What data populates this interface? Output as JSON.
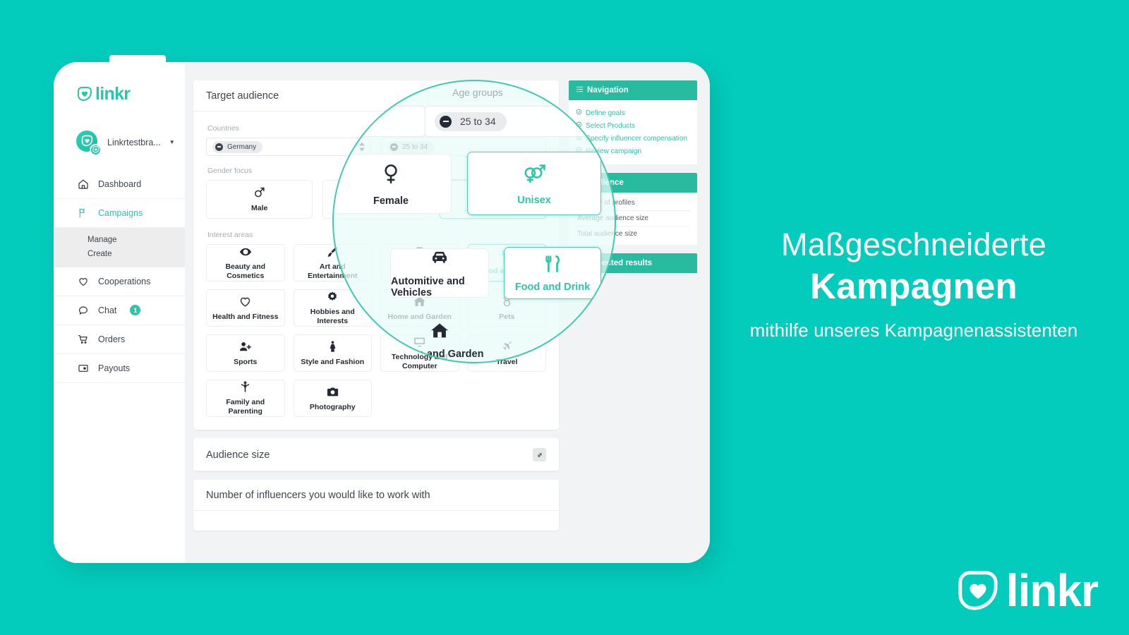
{
  "background_color": "#04ccbc",
  "accent_color": "#2ec4a8",
  "panel_header_color": "#28bba0",
  "promo": {
    "line1": "Maßgeschneiderte",
    "line2": "Kampagnen",
    "line3": "mithilfe unseres Kampagnenassistenten"
  },
  "brand_logo": {
    "word": "linkr",
    "icon": "linkr-shield-heart-icon"
  },
  "sidebar": {
    "logo_word": "linkr",
    "account": {
      "name": "Linkrtestbra...",
      "caret": "▼"
    },
    "items": [
      {
        "label": "Dashboard",
        "icon": "home-icon",
        "active": false
      },
      {
        "label": "Campaigns",
        "icon": "flag-icon",
        "active": true
      },
      {
        "label": "Cooperations",
        "icon": "heart-icon",
        "active": false
      },
      {
        "label": "Chat",
        "icon": "chat-bubble-icon",
        "active": false,
        "badge": "1"
      },
      {
        "label": "Orders",
        "icon": "cart-icon",
        "active": false
      },
      {
        "label": "Payouts",
        "icon": "payout-card-icon",
        "active": false
      }
    ],
    "subnav": [
      {
        "label": "Manage"
      },
      {
        "label": "Create"
      }
    ]
  },
  "main": {
    "target_audience": {
      "title": "Target audience",
      "countries_label": "Countries",
      "country_tags": [
        "Germany"
      ],
      "age_groups_label": "Age groups",
      "age_tags": [
        "25 to 34"
      ],
      "gender_label": "Gender focus",
      "genders": [
        {
          "label": "Male",
          "icon": "mars-icon",
          "selected": false
        },
        {
          "label": "Female",
          "icon": "venus-icon",
          "selected": false
        },
        {
          "label": "Unisex",
          "icon": "unisex-icon",
          "selected": true
        }
      ],
      "interest_label": "Interest areas",
      "interests": [
        {
          "label": "Beauty and Cosmetics",
          "icon": "eye-icon",
          "selected": false
        },
        {
          "label": "Art and Entertainment",
          "icon": "paintbrush-icon",
          "selected": false
        },
        {
          "label": "Automitive and Vehicles",
          "icon": "car-icon",
          "selected": false
        },
        {
          "label": "Food and Drink",
          "icon": "fork-knife-icon",
          "selected": true
        },
        {
          "label": "Health and Fitness",
          "icon": "heart-icon",
          "selected": false
        },
        {
          "label": "Hobbies and Interests",
          "icon": "gear-icon",
          "selected": false
        },
        {
          "label": "Home and Garden",
          "icon": "house-icon",
          "selected": false
        },
        {
          "label": "Pets",
          "icon": "taurus-icon",
          "selected": false
        },
        {
          "label": "Sports",
          "icon": "person-add-icon",
          "selected": false
        },
        {
          "label": "Style and Fashion",
          "icon": "dress-icon",
          "selected": false
        },
        {
          "label": "Technology and Computer",
          "icon": "monitor-icon",
          "selected": false
        },
        {
          "label": "Travel",
          "icon": "plane-icon",
          "selected": false
        },
        {
          "label": "Family and Parenting",
          "icon": "family-icon",
          "selected": false
        },
        {
          "label": "Photography",
          "icon": "camera-icon",
          "selected": false
        }
      ]
    },
    "audience_size": {
      "title": "Audience size",
      "expand_icon": "expand-diagonal-icon"
    },
    "influencers": {
      "title": "Number of influencers you would like to work with"
    }
  },
  "right_panel": {
    "navigation": {
      "title": "Navigation",
      "icon": "list-icon",
      "links": [
        {
          "label": "Define goals",
          "icon": "check-circle-icon"
        },
        {
          "label": "Select Products",
          "icon": "check-circle-icon"
        },
        {
          "label": "Specify influencer compensation",
          "icon": "check-circle-icon"
        },
        {
          "label": "Review campaign",
          "icon": "check-circle-icon"
        }
      ]
    },
    "audience": {
      "title": "Audience",
      "icon": "users-icon",
      "rows": [
        "Number of profiles",
        "Average audience size",
        "Total audience size"
      ]
    },
    "expected_results": {
      "title": "Expected results",
      "icon": "chart-line-icon"
    }
  },
  "magnifier": {
    "age_groups_label": "Age groups",
    "age_tag": "25 to 34",
    "tiles": [
      {
        "label": "Female",
        "icon": "venus-icon",
        "selected": false
      },
      {
        "label": "Unisex",
        "icon": "unisex-icon",
        "selected": true
      },
      {
        "label": "Automitive and Vehicles",
        "icon": "car-icon",
        "selected": false
      },
      {
        "label": "Food and Drink",
        "icon": "fork-knife-icon",
        "selected": true
      },
      {
        "label": "Home and Garden",
        "icon": "house-icon",
        "selected": false
      }
    ]
  }
}
